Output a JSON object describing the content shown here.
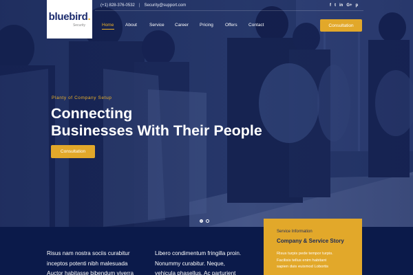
{
  "header": {
    "logo_text": "bluebird",
    "logo_sub": "Security",
    "phone": "(+1) 828-376-0532",
    "email": "Security@support.com",
    "social": [
      "f",
      "t",
      "in",
      "G+",
      "p"
    ],
    "nav": [
      "Home",
      "About",
      "Service",
      "Career",
      "Pricing",
      "Offers",
      "Contact"
    ],
    "cta": "Consultation"
  },
  "hero": {
    "tagline": "Planty of Company Setup",
    "headline_line1": "Connecting",
    "headline_line2": "Businesses With Their People",
    "cta": "Consultation",
    "slide_count": 2,
    "active_slide": 1
  },
  "lower": {
    "para1": [
      "Risus nam nostra sociis curabitur",
      "inceptos potenti nibh malesuada",
      "Auctor habitasse bibendum viverra"
    ],
    "para2": [
      "Libero condimentum fringilla proin.",
      "Nonummy curabitur. Neque,",
      "vehicula phasellus. Ac parturient"
    ]
  },
  "card": {
    "label": "Service Information",
    "title": "Company & Service Story",
    "body": [
      "Risus turpis pede tempor turpis.",
      "Facilisis tellus enim habitant",
      "sapien duis euismod Lobortis"
    ]
  },
  "colors": {
    "navy": "#0b1a4a",
    "accent": "#e2a82a",
    "hero_tint": "#243566"
  },
  "icons": {
    "social": [
      "facebook-icon",
      "twitter-icon",
      "linkedin-icon",
      "google-plus-icon",
      "pinterest-icon"
    ]
  }
}
